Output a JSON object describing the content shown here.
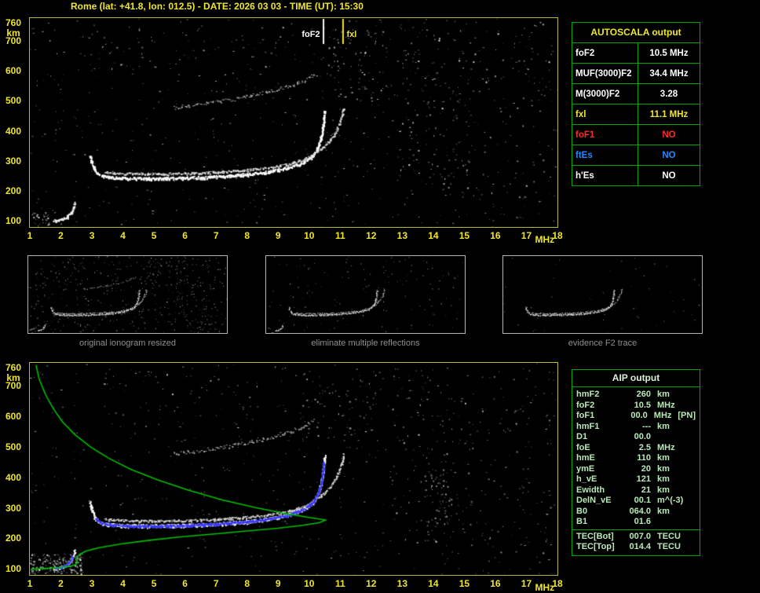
{
  "header": {
    "title": "Rome (lat: +41.8, lon: 012.5) - DATE: 2026 03 03 - TIME (UT): 15:30"
  },
  "autoscala_table": {
    "header": "AUTOSCALA output",
    "rows": [
      {
        "label": "foF2",
        "value": "10.5 MHz",
        "color": "#ffffff"
      },
      {
        "label": "MUF(3000)F2",
        "value": "34.4 MHz",
        "color": "#ffffff"
      },
      {
        "label": "M(3000)F2",
        "value": "3.28",
        "color": "#ffffff"
      },
      {
        "label": "fxl",
        "value": "11.1 MHz",
        "color": "#efe62e"
      },
      {
        "label": "foF1",
        "value": "NO",
        "color": "#ff2a2a"
      },
      {
        "label": "ftEs",
        "value": "NO",
        "color": "#2b86ff"
      },
      {
        "label": "h'Es",
        "value": "NO",
        "color": "#ffffff"
      }
    ]
  },
  "aip_table": {
    "header": "AIP output",
    "rows": [
      {
        "name": "hmF2",
        "value": "260",
        "unit": "km",
        "extra": ""
      },
      {
        "name": "foF2",
        "value": "10.5",
        "unit": "MHz",
        "extra": ""
      },
      {
        "name": "foF1",
        "value": "00.0",
        "unit": "MHz",
        "extra": "[PN]"
      },
      {
        "name": "hmF1",
        "value": "---",
        "unit": "km",
        "extra": ""
      },
      {
        "name": "D1",
        "value": "00.0",
        "unit": "",
        "extra": ""
      },
      {
        "name": "foE",
        "value": "2.5",
        "unit": "MHz",
        "extra": ""
      },
      {
        "name": "hmE",
        "value": "110",
        "unit": "km",
        "extra": ""
      },
      {
        "name": "ymE",
        "value": "20",
        "unit": "km",
        "extra": ""
      },
      {
        "name": "h_vE",
        "value": "121",
        "unit": "km",
        "extra": ""
      },
      {
        "name": "Ewidth",
        "value": "21",
        "unit": "km",
        "extra": ""
      },
      {
        "name": "DelN_vE",
        "value": "00.1",
        "unit": "m^(-3)",
        "extra": ""
      },
      {
        "name": "B0",
        "value": "064.0",
        "unit": "km",
        "extra": ""
      },
      {
        "name": "B1",
        "value": "01.6",
        "unit": "",
        "extra": ""
      }
    ],
    "tec_rows": [
      {
        "name": "TEC[Bot]",
        "value": "007.0",
        "unit": "TECU"
      },
      {
        "name": "TEC[Top]",
        "value": "014.4",
        "unit": "TECU"
      }
    ]
  },
  "thumbnails": [
    {
      "caption": "original ionogram resized",
      "traces": [
        0,
        1,
        2,
        3
      ],
      "noise": 380,
      "cluster_scale": 0.6
    },
    {
      "caption": "eliminate multiple reflections",
      "traces": [
        0,
        1,
        3
      ],
      "noise": 110,
      "cluster_scale": 0.15
    },
    {
      "caption": "evidence F2 trace",
      "traces": [
        0,
        1
      ],
      "noise": 50,
      "cluster_scale": 0
    }
  ],
  "chart_data": [
    {
      "id": "ionogram-top",
      "type": "scatter",
      "title": "",
      "xlabel": "MHz",
      "ylabel": "km",
      "xlim": [
        1,
        18
      ],
      "ylim": [
        80,
        775
      ],
      "x_ticks": [
        "1",
        "2",
        "3",
        "4",
        "5",
        "6",
        "7",
        "8",
        "9",
        "10",
        "11",
        "12",
        "13",
        "14",
        "15",
        "16",
        "17",
        "18"
      ],
      "y_ticks": [
        "760",
        "700",
        "600",
        "500",
        "400",
        "300",
        "200",
        "100"
      ],
      "seed": 11,
      "markers": [
        {
          "label": "foF2",
          "f": 10.45,
          "color": "#ffffff",
          "side": "left"
        },
        {
          "label": "fxl",
          "f": 11.08,
          "color": "#efe62e",
          "side": "right"
        }
      ],
      "traces": [
        {
          "name": "F2-ordinary",
          "color": "#ffffff",
          "width": 2.2,
          "jitter": 3.5,
          "density": 1.7,
          "points": [
            [
              2.92,
              320
            ],
            [
              3.0,
              290
            ],
            [
              3.1,
              268
            ],
            [
              3.25,
              254
            ],
            [
              3.5,
              247
            ],
            [
              4.0,
              243
            ],
            [
              5.0,
              242
            ],
            [
              6.0,
              244
            ],
            [
              7.0,
              248
            ],
            [
              8.0,
              256
            ],
            [
              8.7,
              265
            ],
            [
              9.3,
              278
            ],
            [
              9.8,
              296
            ],
            [
              10.1,
              318
            ],
            [
              10.28,
              348
            ],
            [
              10.38,
              382
            ],
            [
              10.44,
              420
            ],
            [
              10.47,
              452
            ],
            [
              10.49,
              470
            ]
          ]
        },
        {
          "name": "F2-extraordinary",
          "color": "#d9d9d9",
          "width": 1.6,
          "jitter": 3,
          "density": 1.1,
          "points": [
            [
              3.4,
              263
            ],
            [
              4.0,
              259
            ],
            [
              5.0,
              257
            ],
            [
              6.0,
              259
            ],
            [
              7.0,
              263
            ],
            [
              8.0,
              270
            ],
            [
              8.8,
              279
            ],
            [
              9.4,
              292
            ],
            [
              9.9,
              308
            ],
            [
              10.25,
              330
            ],
            [
              10.55,
              356
            ],
            [
              10.8,
              388
            ],
            [
              10.97,
              424
            ],
            [
              11.06,
              455
            ],
            [
              11.1,
              478
            ]
          ]
        },
        {
          "name": "F2-second-hop",
          "color": "#a8a8a8",
          "width": 1.4,
          "jitter": 4.5,
          "density": 0.55,
          "points": [
            [
              5.6,
              478
            ],
            [
              6.3,
              486
            ],
            [
              7.0,
              496
            ],
            [
              7.7,
              508
            ],
            [
              8.4,
              523
            ],
            [
              9.0,
              540
            ],
            [
              9.5,
              556
            ],
            [
              9.9,
              572
            ],
            [
              10.15,
              588
            ]
          ]
        },
        {
          "name": "E-region",
          "color": "#f2f2f2",
          "width": 2,
          "jitter": 3,
          "density": 1.6,
          "points": [
            [
              1.75,
              101
            ],
            [
              1.95,
              104
            ],
            [
              2.1,
              110
            ],
            [
              2.25,
              119
            ],
            [
              2.33,
              131
            ],
            [
              2.4,
              146
            ],
            [
              2.44,
              162
            ]
          ]
        }
      ],
      "noise": {
        "count": 620,
        "clusters": [
          {
            "f1": 12.8,
            "f2": 15.4,
            "h1": 150,
            "h2": 770,
            "count": 150
          },
          {
            "f1": 10.6,
            "f2": 12.5,
            "h1": 500,
            "h2": 770,
            "count": 80
          },
          {
            "f1": 15.5,
            "f2": 17.9,
            "h1": 90,
            "h2": 770,
            "count": 70
          },
          {
            "f1": 1.0,
            "f2": 1.6,
            "h1": 85,
            "h2": 130,
            "count": 28,
            "bright": true
          },
          {
            "f1": 3.0,
            "f2": 9.5,
            "h1": 600,
            "h2": 770,
            "count": 45
          }
        ]
      }
    },
    {
      "id": "ionogram-bottom-with-profile",
      "type": "scatter",
      "title": "",
      "xlabel": "MHz",
      "ylabel": "km",
      "xlim": [
        1,
        18
      ],
      "ylim": [
        80,
        775
      ],
      "x_ticks": [
        "1",
        "2",
        "3",
        "4",
        "5",
        "6",
        "7",
        "8",
        "9",
        "10",
        "11",
        "12",
        "13",
        "14",
        "15",
        "16",
        "17",
        "18"
      ],
      "y_ticks": [
        "760",
        "700",
        "600",
        "500",
        "400",
        "300",
        "200",
        "100"
      ],
      "seed": 29,
      "markers": [],
      "traces": [
        {
          "name": "F2-ordinary",
          "color": "#ffffff",
          "width": 2.2,
          "jitter": 3.5,
          "density": 1.7,
          "points": [
            [
              2.92,
              320
            ],
            [
              3.0,
              290
            ],
            [
              3.1,
              268
            ],
            [
              3.25,
              254
            ],
            [
              3.5,
              247
            ],
            [
              4.0,
              243
            ],
            [
              5.0,
              242
            ],
            [
              6.0,
              244
            ],
            [
              7.0,
              248
            ],
            [
              8.0,
              256
            ],
            [
              8.7,
              265
            ],
            [
              9.3,
              278
            ],
            [
              9.8,
              296
            ],
            [
              10.1,
              318
            ],
            [
              10.28,
              348
            ],
            [
              10.38,
              382
            ],
            [
              10.44,
              420
            ],
            [
              10.47,
              452
            ],
            [
              10.49,
              470
            ]
          ]
        },
        {
          "name": "F2-extraordinary",
          "color": "#d9d9d9",
          "width": 1.6,
          "jitter": 3,
          "density": 1.1,
          "points": [
            [
              3.4,
              263
            ],
            [
              4.0,
              259
            ],
            [
              5.0,
              257
            ],
            [
              6.0,
              259
            ],
            [
              7.0,
              263
            ],
            [
              8.0,
              270
            ],
            [
              8.8,
              279
            ],
            [
              9.4,
              292
            ],
            [
              9.9,
              308
            ],
            [
              10.25,
              330
            ],
            [
              10.55,
              356
            ],
            [
              10.8,
              388
            ],
            [
              10.97,
              424
            ],
            [
              11.06,
              455
            ],
            [
              11.1,
              478
            ]
          ]
        },
        {
          "name": "F2-second-hop",
          "color": "#a8a8a8",
          "width": 1.4,
          "jitter": 4.5,
          "density": 0.55,
          "points": [
            [
              5.6,
              478
            ],
            [
              6.3,
              486
            ],
            [
              7.0,
              496
            ],
            [
              7.7,
              508
            ],
            [
              8.4,
              523
            ],
            [
              9.0,
              540
            ],
            [
              9.5,
              556
            ],
            [
              9.9,
              572
            ],
            [
              10.15,
              588
            ]
          ]
        },
        {
          "name": "E-region",
          "color": "#f2f2f2",
          "width": 2,
          "jitter": 3,
          "density": 1.6,
          "points": [
            [
              1.75,
              101
            ],
            [
              1.95,
              104
            ],
            [
              2.1,
              110
            ],
            [
              2.25,
              119
            ],
            [
              2.33,
              131
            ],
            [
              2.4,
              146
            ],
            [
              2.44,
              162
            ]
          ]
        },
        {
          "name": "autoscaled-F2-trace",
          "color": "#3939ff",
          "width": 2.2,
          "jitter": 2.4,
          "density": 1.6,
          "points": [
            [
              3.1,
              266
            ],
            [
              3.3,
              252
            ],
            [
              3.6,
              246
            ],
            [
              4.2,
              242
            ],
            [
              5.0,
              242
            ],
            [
              6.0,
              244
            ],
            [
              7.0,
              248
            ],
            [
              8.0,
              256
            ],
            [
              8.7,
              265
            ],
            [
              9.3,
              278
            ],
            [
              9.8,
              296
            ],
            [
              10.1,
              318
            ],
            [
              10.28,
              348
            ],
            [
              10.38,
              382
            ],
            [
              10.44,
              420
            ],
            [
              10.46,
              450
            ]
          ]
        },
        {
          "name": "autoscaled-E-trace",
          "color": "#3939ff",
          "width": 1.8,
          "jitter": 2.4,
          "density": 1.4,
          "points": [
            [
              1.8,
              101
            ],
            [
              2.0,
              106
            ],
            [
              2.18,
              114
            ],
            [
              2.3,
              127
            ],
            [
              2.37,
              142
            ]
          ]
        }
      ],
      "lines": [
        {
          "name": "electron-density-profile",
          "color": "#00c000",
          "width": 1.6,
          "points": [
            [
              1.2,
              768
            ],
            [
              1.3,
              722
            ],
            [
              1.5,
              672
            ],
            [
              1.75,
              626
            ],
            [
              2.05,
              582
            ],
            [
              2.45,
              540
            ],
            [
              2.95,
              500
            ],
            [
              3.55,
              462
            ],
            [
              4.25,
              426
            ],
            [
              5.1,
              392
            ],
            [
              6.1,
              358
            ],
            [
              7.2,
              326
            ],
            [
              8.3,
              300
            ],
            [
              9.25,
              281
            ],
            [
              9.95,
              269
            ],
            [
              10.4,
              262
            ],
            [
              10.52,
              260
            ],
            [
              10.35,
              252
            ],
            [
              9.8,
              243
            ],
            [
              9.0,
              233
            ],
            [
              8.0,
              224
            ],
            [
              6.9,
              214
            ],
            [
              5.8,
              204
            ],
            [
              4.8,
              193
            ],
            [
              3.9,
              181
            ],
            [
              3.2,
              169
            ],
            [
              2.8,
              158
            ],
            [
              2.6,
              147
            ],
            [
              2.52,
              137
            ],
            [
              2.5,
              128
            ],
            [
              2.55,
              122
            ],
            [
              2.48,
              114
            ],
            [
              2.3,
              108
            ],
            [
              1.9,
              104
            ],
            [
              1.45,
              101
            ],
            [
              1.05,
              99
            ]
          ]
        }
      ],
      "noise": {
        "count": 520,
        "clusters": [
          {
            "f1": 1.0,
            "f2": 2.7,
            "h1": 85,
            "h2": 150,
            "count": 200,
            "bright": true
          },
          {
            "f1": 12.6,
            "f2": 15.3,
            "h1": 150,
            "h2": 770,
            "count": 120
          },
          {
            "f1": 9.5,
            "f2": 12.2,
            "h1": 520,
            "h2": 740,
            "count": 70
          },
          {
            "f1": 13.7,
            "f2": 14.6,
            "h1": 230,
            "h2": 430,
            "count": 55
          },
          {
            "f1": 15.5,
            "f2": 17.9,
            "h1": 90,
            "h2": 770,
            "count": 55
          },
          {
            "f1": 3.0,
            "f2": 9.0,
            "h1": 560,
            "h2": 770,
            "count": 40
          }
        ]
      }
    }
  ]
}
